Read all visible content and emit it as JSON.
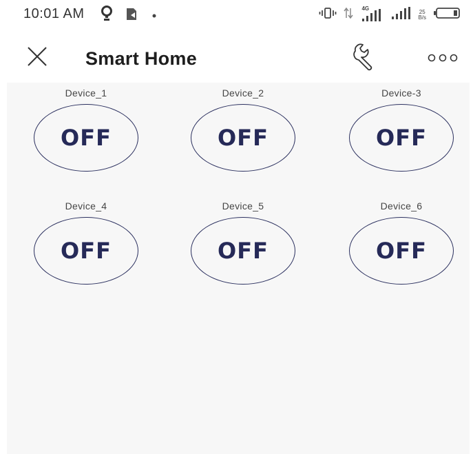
{
  "status_bar": {
    "time": "10:01 AM",
    "left_icons": [
      "location-pin-icon",
      "battery-saver-icon",
      "dot-icon"
    ],
    "network_type": "4G",
    "speed_value": "25",
    "speed_unit": "B/s"
  },
  "header": {
    "title": "Smart Home",
    "close_icon": "close-icon",
    "settings_icon": "wrench-icon",
    "more_icon": "more-icon"
  },
  "devices": [
    {
      "label": "Device_1",
      "state": "OFF"
    },
    {
      "label": "Device_2",
      "state": "OFF"
    },
    {
      "label": "Device-3",
      "state": "OFF"
    },
    {
      "label": "Device_4",
      "state": "OFF"
    },
    {
      "label": "Device_5",
      "state": "OFF"
    },
    {
      "label": "Device_6",
      "state": "OFF"
    }
  ],
  "colors": {
    "accent": "#262a58",
    "content_bg": "#f7f7f7"
  }
}
